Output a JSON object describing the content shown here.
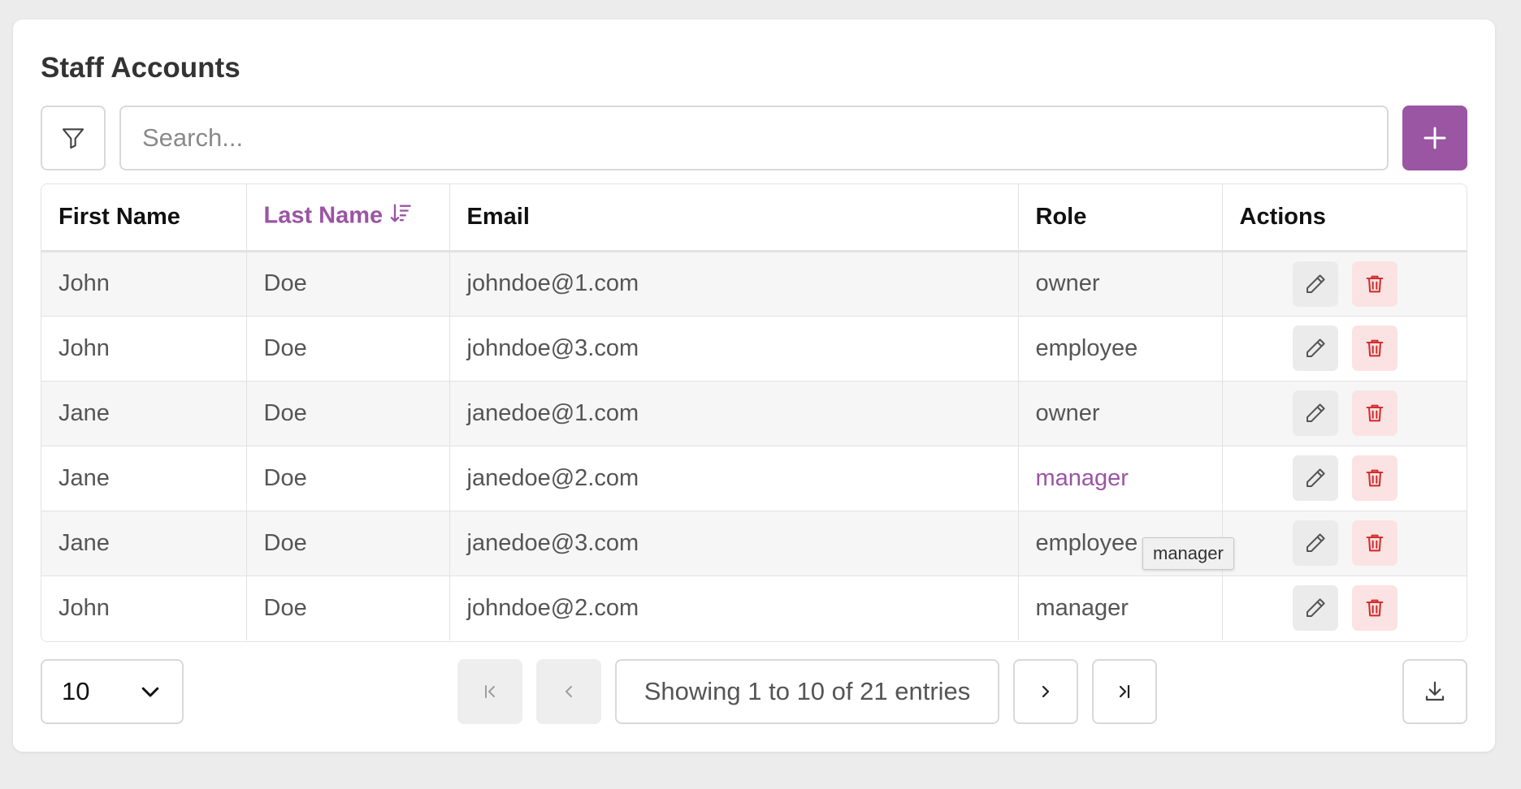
{
  "card": {
    "title": "Staff Accounts"
  },
  "toolbar": {
    "filter_icon": "filter-icon",
    "search_placeholder": "Search...",
    "search_value": "",
    "add_icon": "plus-icon"
  },
  "table": {
    "columns": [
      {
        "label": "First Name",
        "sorted": false
      },
      {
        "label": "Last Name",
        "sorted": true,
        "sort_direction": "descending"
      },
      {
        "label": "Email",
        "sorted": false
      },
      {
        "label": "Role",
        "sorted": false
      },
      {
        "label": "Actions",
        "sorted": false
      }
    ],
    "rows": [
      {
        "first": "John",
        "last": "Doe",
        "email": "johndoe@1.com",
        "role": "owner"
      },
      {
        "first": "John",
        "last": "Doe",
        "email": "johndoe@3.com",
        "role": "employee"
      },
      {
        "first": "Jane",
        "last": "Doe",
        "email": "janedoe@1.com",
        "role": "owner"
      },
      {
        "first": "Jane",
        "last": "Doe",
        "email": "janedoe@2.com",
        "role": "manager",
        "hovered": true
      },
      {
        "first": "Jane",
        "last": "Doe",
        "email": "janedoe@3.com",
        "role": "employee"
      },
      {
        "first": "John",
        "last": "Doe",
        "email": "johndoe@2.com",
        "role": "manager"
      }
    ],
    "row_actions": [
      "edit-icon",
      "trash-icon"
    ]
  },
  "tooltip": {
    "text": "manager"
  },
  "pagination": {
    "page_size": "10",
    "status": "Showing 1 to 10 of 21 entries",
    "first_disabled": true,
    "prev_disabled": true,
    "next_disabled": false,
    "last_disabled": false
  },
  "colors": {
    "accent": "#9a55a3",
    "danger": "#d32f2f",
    "danger_bg": "#fbe3e3"
  }
}
